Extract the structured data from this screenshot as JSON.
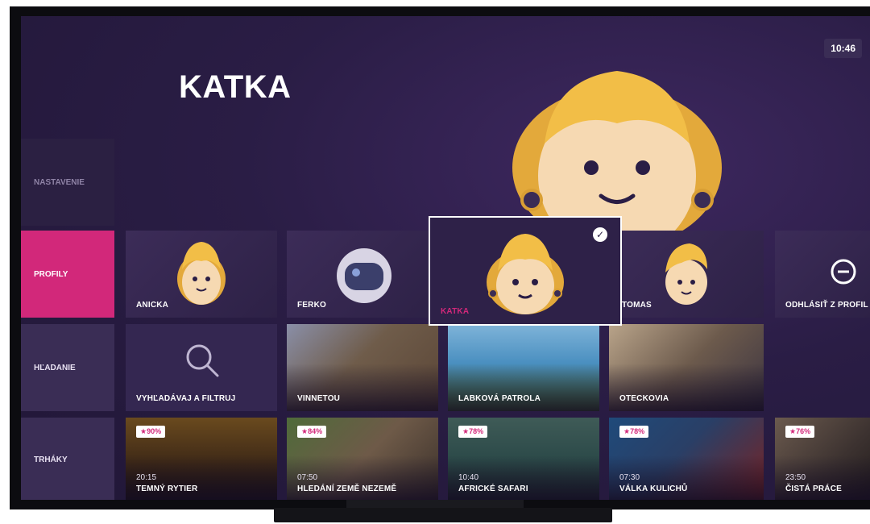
{
  "clock": "10:46",
  "profile": {
    "name": "KATKA"
  },
  "sidebar": {
    "items": [
      {
        "label": "NASTAVENIE"
      },
      {
        "label": "PROFILY"
      },
      {
        "label": "HĽADANIE"
      },
      {
        "label": "TRHÁKY"
      }
    ]
  },
  "profiles_row": {
    "items": [
      {
        "name": "ANICKA"
      },
      {
        "name": "FERKO"
      },
      {
        "name": "KATKA"
      },
      {
        "name": "TOMAS"
      }
    ],
    "logout_label": "ODHLÁSIŤ Z PROFIL"
  },
  "search_row": {
    "search_label": "VYHĽADÁVAJ A FILTRUJ",
    "items": [
      {
        "title": "VINNETOU"
      },
      {
        "title": "LABKOVÁ PATROLA"
      },
      {
        "title": "OTECKOVIA"
      }
    ]
  },
  "hits_row": {
    "items": [
      {
        "rating": "★90%",
        "time": "20:15",
        "title": "TEMNÝ RYTIER"
      },
      {
        "rating": "★84%",
        "time": "07:50",
        "title": "HLEDÁNÍ ZEMĚ NEZEMĚ"
      },
      {
        "rating": "★78%",
        "time": "10:40",
        "title": "AFRICKÉ SAFARI"
      },
      {
        "rating": "★78%",
        "time": "07:30",
        "title": "VÁLKA KULICHŮ"
      },
      {
        "rating": "★76%",
        "time": "23:50",
        "title": "ČISTÁ PRÁCE"
      }
    ]
  },
  "colors": {
    "accent": "#d2287a",
    "background": "#2a1d45",
    "tile": "#3a2c55"
  }
}
